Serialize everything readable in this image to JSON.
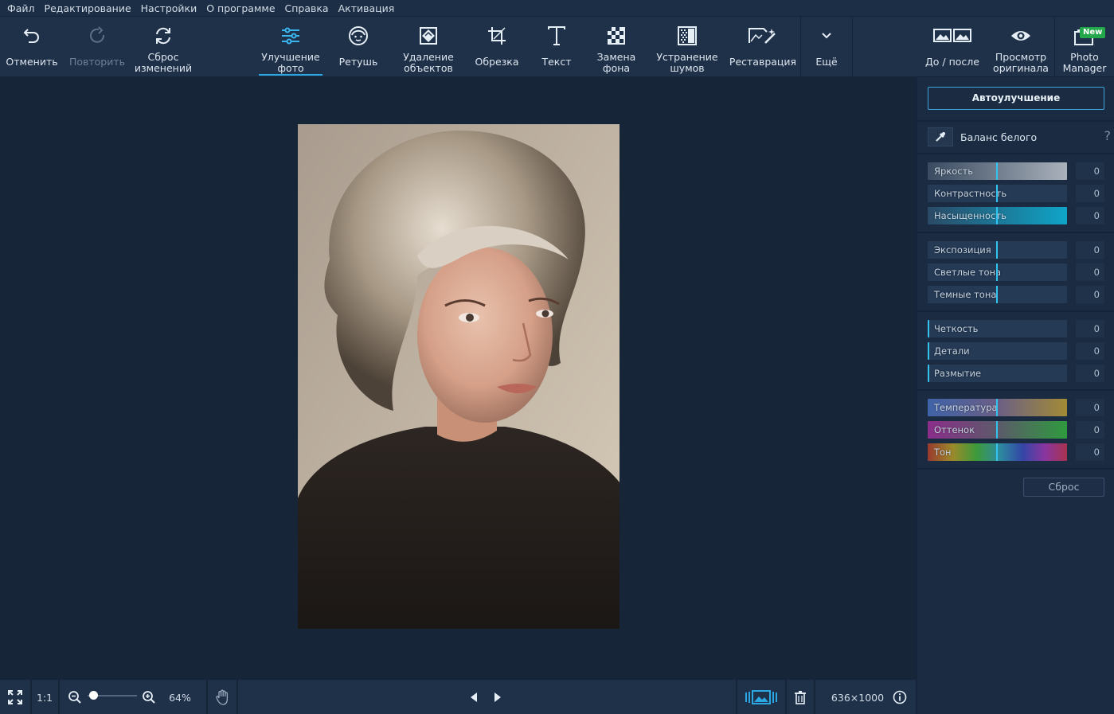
{
  "menu": [
    "Файл",
    "Редактирование",
    "Настройки",
    "О программе",
    "Справка",
    "Активация"
  ],
  "toolbar": {
    "undo": "Отменить",
    "redo": "Повторить",
    "reset_changes": "Сброс\nизменений",
    "enhance": "Улучшение\nфото",
    "retouch": "Ретушь",
    "remove_objects": "Удаление\nобъектов",
    "crop": "Обрезка",
    "text": "Текст",
    "replace_bg": "Замена\nфона",
    "denoise": "Устранение\nшумов",
    "restore": "Реставрация",
    "more": "Ещё",
    "before_after": "До / после",
    "view_original": "Просмотр\nоригинала",
    "photo_manager": "Photo\nManager",
    "new_badge": "New"
  },
  "panel": {
    "auto_enhance": "Автоулучшение",
    "white_balance": "Баланс белого",
    "help": "?",
    "reset": "Сброс",
    "sliders": [
      {
        "label": "Яркость",
        "value": "0"
      },
      {
        "label": "Контрастность",
        "value": "0"
      },
      {
        "label": "Насыщенность",
        "value": "0"
      },
      {
        "label": "Экспозиция",
        "value": "0"
      },
      {
        "label": "Светлые тона",
        "value": "0"
      },
      {
        "label": "Темные тона",
        "value": "0"
      },
      {
        "label": "Четкость",
        "value": "0"
      },
      {
        "label": "Детали",
        "value": "0"
      },
      {
        "label": "Размытие",
        "value": "0"
      },
      {
        "label": "Температура",
        "value": "0"
      },
      {
        "label": "Оттенок",
        "value": "0"
      },
      {
        "label": "Тон",
        "value": "0"
      }
    ]
  },
  "bottom": {
    "zoom_1to1": "1:1",
    "zoom_level": "64%",
    "zoom_fraction": 0.64,
    "image_size": "636×1000"
  },
  "colors": {
    "accent": "#2ba7e3",
    "badge": "#22a84a"
  }
}
